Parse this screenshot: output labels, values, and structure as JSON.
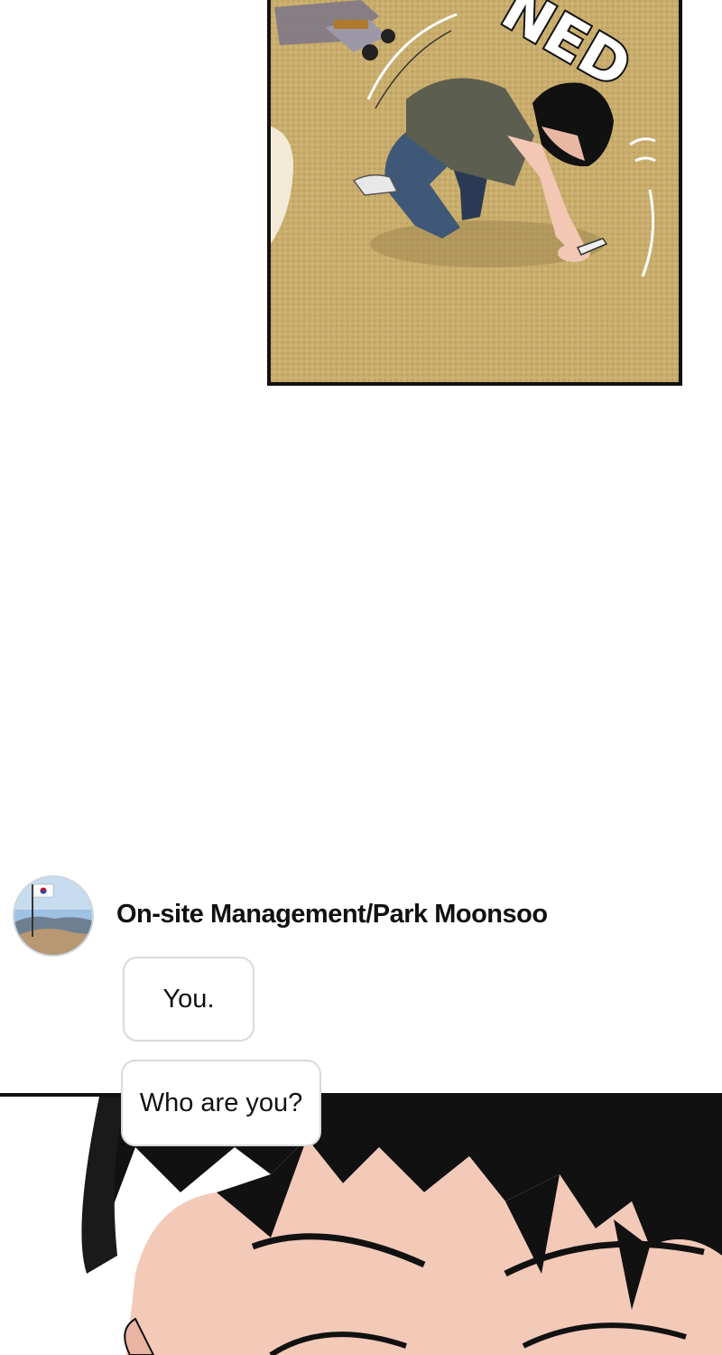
{
  "top_panel": {
    "sfx_text": "NED"
  },
  "chat": {
    "sender_name": "On-site Management/Park Moonsoo",
    "messages": [
      {
        "text": "You."
      },
      {
        "text": "Who are you?"
      }
    ]
  },
  "icons": {
    "avatar": "profile-photo-flag-mountain",
    "flag": "korean-flag-icon"
  },
  "colors": {
    "ground": "#c9ad6c",
    "panel_border": "#111111",
    "bubble_border": "#d9d9d9"
  }
}
